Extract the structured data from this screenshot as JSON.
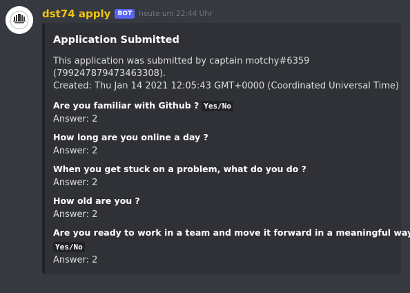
{
  "message": {
    "author": "dst74 apply",
    "bot_tag": "BOT",
    "timestamp": "heute um 22:44 Uhr",
    "author_color": "#f1c40f"
  },
  "embed": {
    "title": "Application Submitted",
    "description_line1": "This application was submitted by captain motchy#6359",
    "description_line2": "(799247879473463308).",
    "description_line3": "Created: Thu Jan 14 2021 12:05:43 GMT+0000 (Coordinated Universal Time)",
    "fields": [
      {
        "name": "Are you familiar with Github ?",
        "code": "Yes/No",
        "value": "Answer: 2"
      },
      {
        "name": "How long are you online a day ?",
        "value": "Answer: 2"
      },
      {
        "name": "When you get stuck on a problem, what do you do ?",
        "value": "Answer: 2"
      },
      {
        "name": "How old are you ?",
        "value": "Answer: 2"
      },
      {
        "name": "Are you ready to work in a team and move it forward in a meaningful way ?",
        "code": "Yes/No",
        "value": "Answer: 2"
      }
    ]
  },
  "colors": {
    "background": "#36393f",
    "embed_background": "#2f3136",
    "embed_border": "#202225",
    "bot_tag": "#5865f2",
    "timestamp": "#72767d"
  },
  "icons": {
    "avatar": "castle-logo-avatar"
  }
}
